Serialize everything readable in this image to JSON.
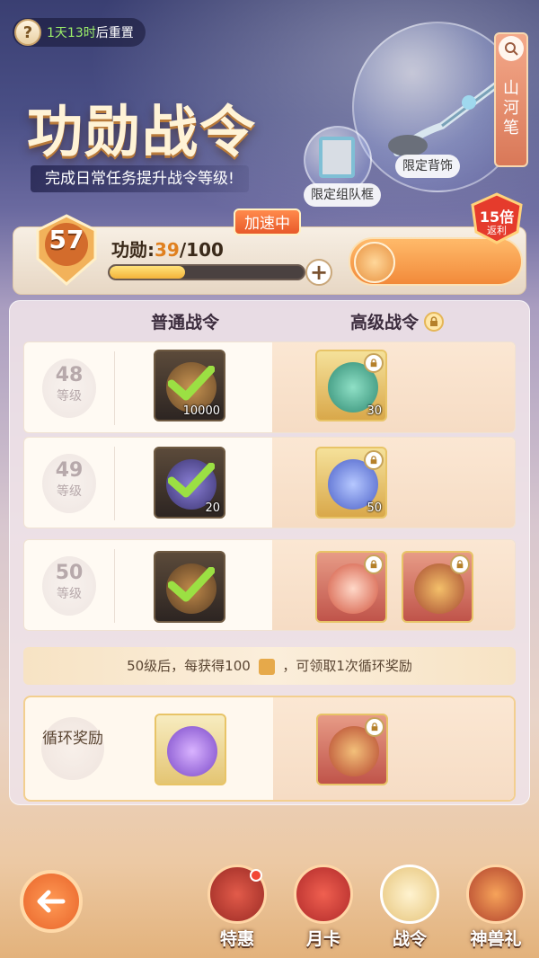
{
  "header": {
    "reset_prefix": "1天13时",
    "reset_suffix": "后重置",
    "title": "功勋战令",
    "subtitle": "完成日常任务提升战令等级!",
    "showcase_tag_frame": "限定组队框",
    "showcase_tag_back": "限定背饰",
    "side_banner_title": "山河笔"
  },
  "progress": {
    "level": "57",
    "boost_tag": "加速中",
    "merit_label": "功勋:",
    "merit_current": "39",
    "merit_total": "/100",
    "merit_fraction": 0.39,
    "rebate_mult": "15倍",
    "rebate_sub": "返利"
  },
  "columns": {
    "normal": "普通战令",
    "premium": "高级战令"
  },
  "level_word": "等级",
  "rows": [
    {
      "level": "48",
      "normal_qty": "10000",
      "premium_qty": "30"
    },
    {
      "level": "49",
      "normal_qty": "20",
      "premium_qty": "50"
    },
    {
      "level": "50",
      "normal_qty": "",
      "premium_qty": ""
    }
  ],
  "loop": {
    "note": "50级后，每获得100",
    "note_suffix": "，可领取1次循环奖励",
    "label": "循环奖励"
  },
  "nav": {
    "items": [
      {
        "label": "特惠"
      },
      {
        "label": "月卡"
      },
      {
        "label": "战令"
      },
      {
        "label": "神兽礼"
      }
    ]
  },
  "colors": {
    "accent": "#f28a3a",
    "check": "#8fd43a"
  }
}
